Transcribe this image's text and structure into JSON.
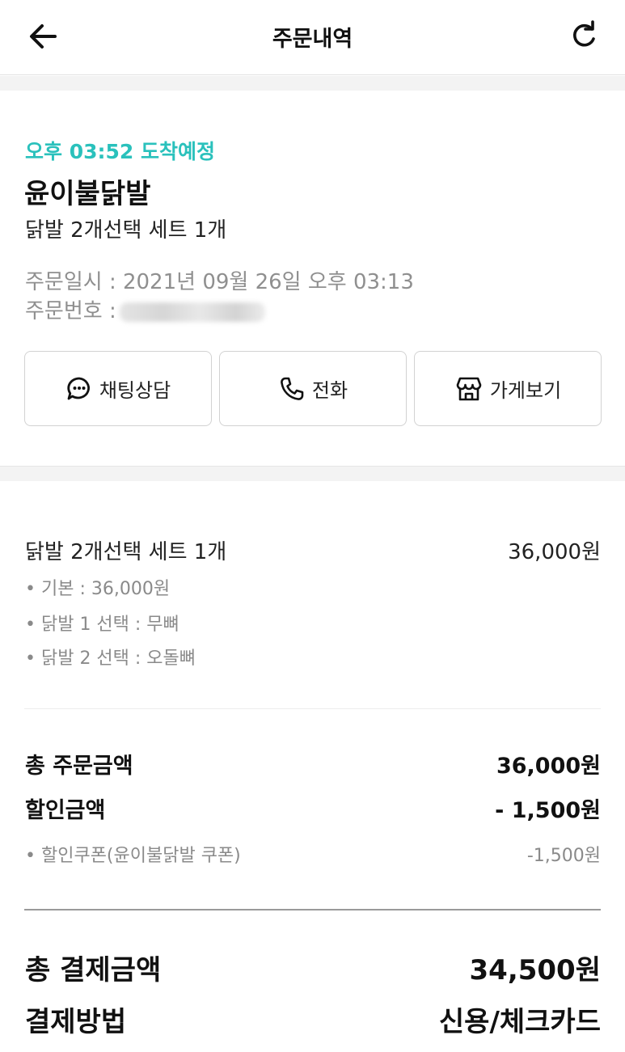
{
  "header": {
    "title": "주문내역"
  },
  "order": {
    "eta": "오후 03:52 도착예정",
    "store_name": "윤이불닭발",
    "menu_summary": "닭발 2개선택 세트 1개",
    "order_datetime": "주문일시 : 2021년 09월 26일 오후 03:13",
    "order_number_label": "주문번호 :"
  },
  "actions": {
    "chat_label": "채팅상담",
    "call_label": "전화",
    "store_label": "가게보기"
  },
  "item": {
    "name": "닭발 2개선택 세트 1개",
    "price": "36,000원",
    "options": [
      "• 기본 : 36,000원",
      "• 닭발 1 선택 : 무뼈",
      "• 닭발 2 선택 : 오돌뼈"
    ]
  },
  "summary": {
    "total_order_label": "총 주문금액",
    "total_order_value": "36,000원",
    "discount_label": "할인금액",
    "discount_value": "- 1,500원",
    "coupon_label": "• 할인쿠폰(윤이불닭발 쿠폰)",
    "coupon_value": "-1,500원",
    "total_payment_label": "총 결제금액",
    "total_payment_value": "34,500원",
    "payment_method_label": "결제방법",
    "payment_method_value": "신용/체크카드"
  },
  "colors": {
    "accent": "#2ac1bc",
    "muted": "#8f8f8f"
  },
  "icons": [
    "back-arrow-icon",
    "refresh-icon",
    "chat-bubble-icon",
    "phone-icon",
    "store-icon"
  ]
}
